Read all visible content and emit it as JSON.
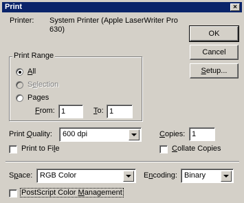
{
  "window": {
    "title": "Print",
    "close_glyph": "×"
  },
  "printer": {
    "label": "Printer:",
    "name_line1": "System Printer (Apple LaserWriter Pro",
    "name_line2": "630)"
  },
  "buttons": {
    "ok": "OK",
    "cancel": "Cancel",
    "setup_u": "S",
    "setup_rest": "etup..."
  },
  "print_range": {
    "label": "Print Range",
    "all_u": "A",
    "all_rest": "ll",
    "selection_pre": "S",
    "selection_u": "e",
    "selection_rest": "lection",
    "pages": "Pages",
    "from_u": "F",
    "from_rest": "rom:",
    "from_value": "1",
    "to_u": "T",
    "to_rest": "o:",
    "to_value": "1",
    "selected": "All"
  },
  "quality": {
    "label_pre": "Print ",
    "label_u": "Q",
    "label_rest": "uality:",
    "value": "600 dpi"
  },
  "copies": {
    "label_u": "C",
    "label_rest": "opies:",
    "value": "1"
  },
  "print_to_file": {
    "pre": "Print to Fi",
    "u": "l",
    "rest": "e",
    "checked": false
  },
  "collate": {
    "u": "C",
    "rest": "ollate Copies",
    "checked": false
  },
  "space": {
    "label_pre": "S",
    "label_u": "p",
    "label_rest": "ace:",
    "value": "RGB Color"
  },
  "encoding": {
    "label_pre": "E",
    "label_u": "n",
    "label_rest": "coding:",
    "value": "Binary"
  },
  "postscript": {
    "pre": "PostScript Color ",
    "u": "M",
    "rest": "anagement",
    "checked": false
  }
}
